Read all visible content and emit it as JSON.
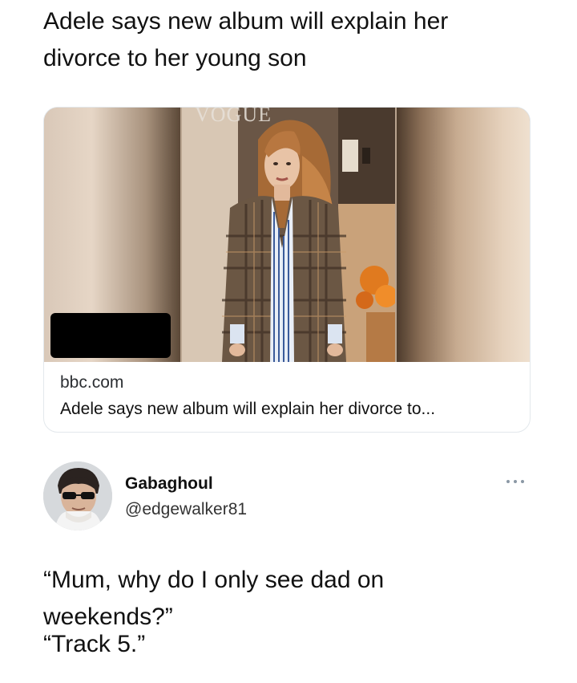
{
  "post": {
    "title_line1": "Adele says new album will explain her",
    "title_line2": "divorce to her young son"
  },
  "link_card": {
    "image_watermark": "VOGUE",
    "domain": "bbc.com",
    "headline": "Adele says new album will explain her divorce to..."
  },
  "reply": {
    "display_name": "Gabaghoul",
    "handle": "@edgewalker81",
    "text_line1": "“Mum, why do I only see dad on",
    "text_line2": "weekends?”",
    "text_line3": "“Track 5.”"
  },
  "icons": {
    "more": "more-options-icon"
  },
  "colors": {
    "text": "#111111",
    "muted": "#333333",
    "card_border": "#e3e8ec"
  }
}
